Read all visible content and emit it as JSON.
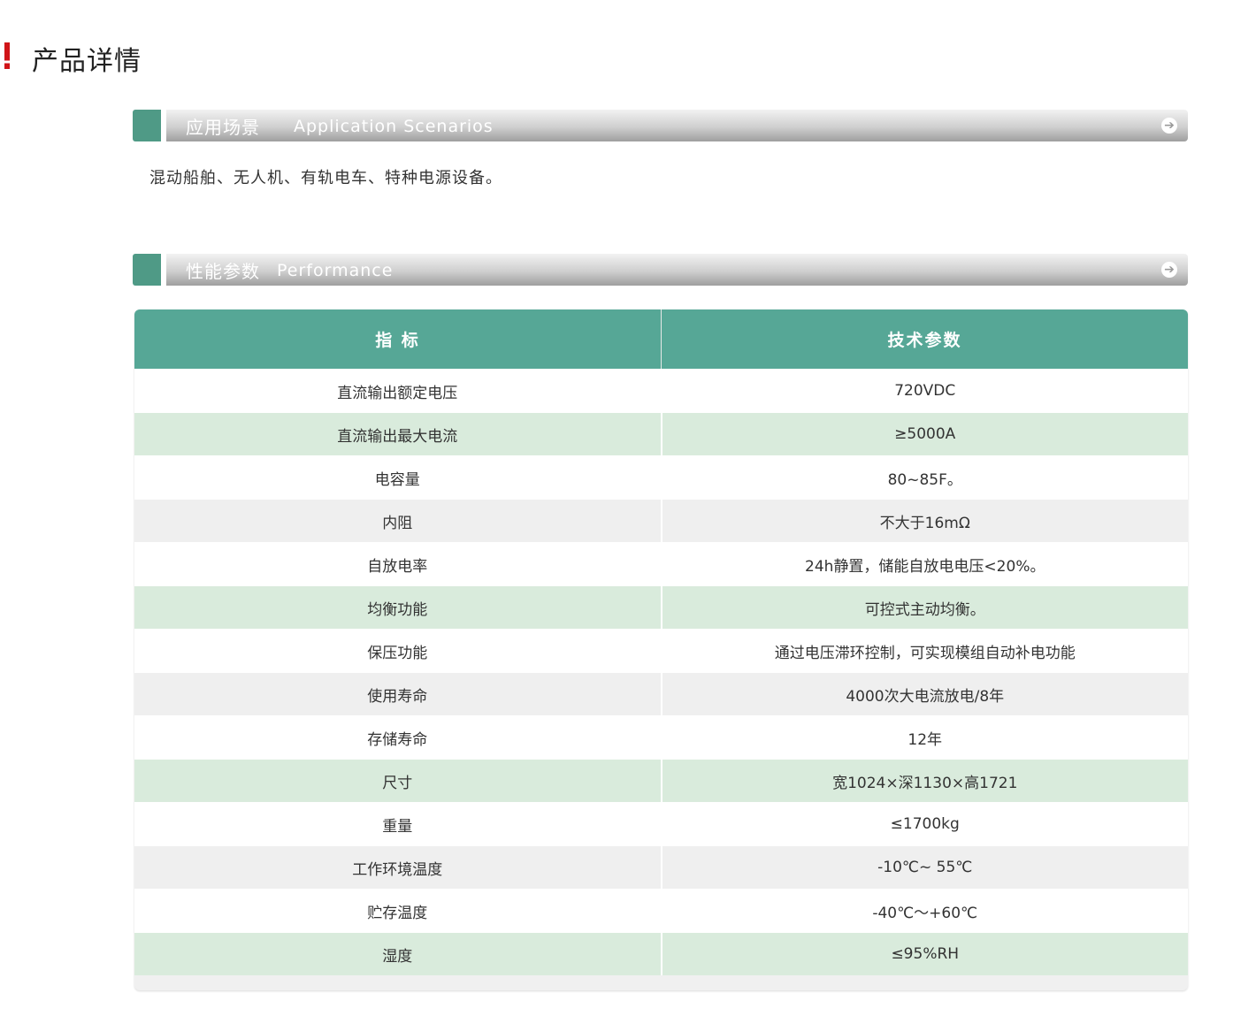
{
  "page": {
    "title": "产品详情"
  },
  "section_application": {
    "title_cn": "应用场景",
    "title_en": "Application Scenarios",
    "content": "混动船舶、无人机、有轨电车、特种电源设备。"
  },
  "section_performance": {
    "title_cn": "性能参数",
    "title_en": "Performance"
  },
  "icons": {
    "arrow": "arrow-circle-right-icon"
  },
  "colors": {
    "accent_red": "#d01418",
    "header_green": "#56a796",
    "tab_green": "#4f9a86",
    "row_green": "#d9ebdc",
    "row_gray": "#efefef"
  },
  "table": {
    "headers": [
      "指 标",
      "技术参数"
    ],
    "rows": [
      {
        "label": "直流输出额定电压",
        "value": "720VDC",
        "shade": "white"
      },
      {
        "label": "直流输出最大电流",
        "value": "≥5000A",
        "shade": "green"
      },
      {
        "label": "电容量",
        "value": "80~85F。",
        "shade": "white"
      },
      {
        "label": "内阻",
        "value": "不大于16mΩ",
        "shade": "gray"
      },
      {
        "label": "自放电率",
        "value": "24h静置，储能自放电电压<20%。",
        "shade": "white"
      },
      {
        "label": "均衡功能",
        "value": "可控式主动均衡。",
        "shade": "green"
      },
      {
        "label": "保压功能",
        "value": "通过电压滞环控制，可实现模组自动补电功能",
        "shade": "white"
      },
      {
        "label": "使用寿命",
        "value": "4000次大电流放电/8年",
        "shade": "gray"
      },
      {
        "label": "存储寿命",
        "value": "12年",
        "shade": "white"
      },
      {
        "label": "尺寸",
        "value": "宽1024×深1130×高1721",
        "shade": "green"
      },
      {
        "label": "重量",
        "value": "≤1700kg",
        "shade": "white"
      },
      {
        "label": "工作环境温度",
        "value": "-10℃~ 55℃",
        "shade": "gray"
      },
      {
        "label": "贮存温度",
        "value": "-40℃～+60℃",
        "shade": "white"
      },
      {
        "label": "湿度",
        "value": "≤95%RH",
        "shade": "green"
      }
    ]
  }
}
